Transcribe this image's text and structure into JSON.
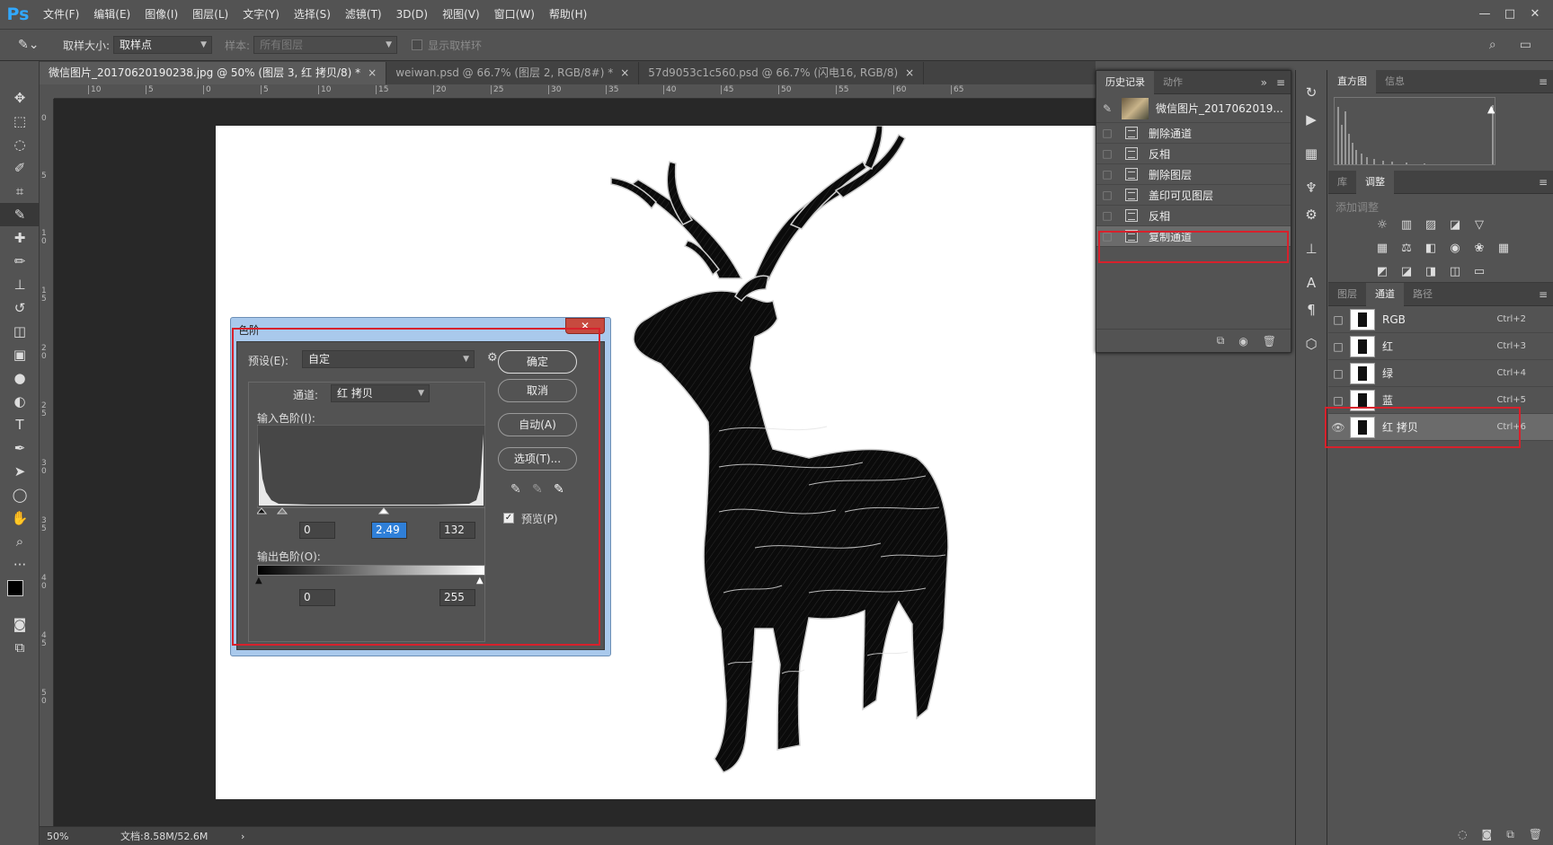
{
  "app": {
    "logo": "Ps",
    "menus": [
      "文件(F)",
      "编辑(E)",
      "图像(I)",
      "图层(L)",
      "文字(Y)",
      "选择(S)",
      "滤镜(T)",
      "3D(D)",
      "视图(V)",
      "窗口(W)",
      "帮助(H)"
    ],
    "window_controls": {
      "minimize": "—",
      "restore": "□",
      "close": "✕"
    }
  },
  "options_bar": {
    "sample_size_label": "取样大小:",
    "sample_size_value": "取样点",
    "sample_label": "样本:",
    "sample_value": "所有图层",
    "show_ring_label": "显示取样环"
  },
  "tabs": [
    {
      "label": "微信图片_20170620190238.jpg @ 50% (图层 3, 红 拷贝/8) *",
      "close": "×"
    },
    {
      "label": "weiwan.psd @ 66.7% (图层 2, RGB/8#) *",
      "close": "×"
    },
    {
      "label": "57d9053c1c560.psd @ 66.7% (闪电16, RGB/8)",
      "close": "×"
    }
  ],
  "ruler_h": [
    "10",
    "5",
    "0",
    "5",
    "10",
    "15",
    "20",
    "25",
    "30",
    "35",
    "40",
    "45",
    "50",
    "55",
    "60",
    "65"
  ],
  "ruler_v": [
    "0",
    "5",
    "1 0",
    "1 5",
    "2 0",
    "2 5",
    "3 0",
    "3 5",
    "4 0",
    "4 5",
    "5 0"
  ],
  "status": {
    "zoom": "50%",
    "doc": "文档:8.58M/52.6M",
    "arrow": "›"
  },
  "history": {
    "tabs": [
      "历史记录",
      "动作"
    ],
    "snapshot": "微信图片_2017062019...",
    "items": [
      "删除通道",
      "反相",
      "删除图层",
      "盖印可见图层",
      "反相",
      "复制通道"
    ],
    "selected_index": 5
  },
  "histogram": {
    "tabs": [
      "直方图",
      "信息"
    ]
  },
  "library": {
    "tabs": [
      "库",
      "调整"
    ],
    "add_adjust": "添加调整"
  },
  "channels": {
    "tabs": [
      "图层",
      "通道",
      "路径"
    ],
    "items": [
      {
        "name": "RGB",
        "shortcut": "Ctrl+2"
      },
      {
        "name": "红",
        "shortcut": "Ctrl+3"
      },
      {
        "name": "绿",
        "shortcut": "Ctrl+4"
      },
      {
        "name": "蓝",
        "shortcut": "Ctrl+5"
      },
      {
        "name": "红 拷贝",
        "shortcut": "Ctrl+6"
      }
    ]
  },
  "levels_dialog": {
    "title": "色阶",
    "preset_label": "预设(E):",
    "preset_value": "自定",
    "channel_label": "通道:",
    "channel_value": "红 拷贝",
    "input_label": "输入色阶(I):",
    "input_values": [
      "0",
      "2.49",
      "132"
    ],
    "output_label": "输出色阶(O):",
    "output_values": [
      "0",
      "255"
    ],
    "ok": "确定",
    "cancel": "取消",
    "auto": "自动(A)",
    "options": "选项(T)...",
    "preview_label": "预览(P)"
  }
}
